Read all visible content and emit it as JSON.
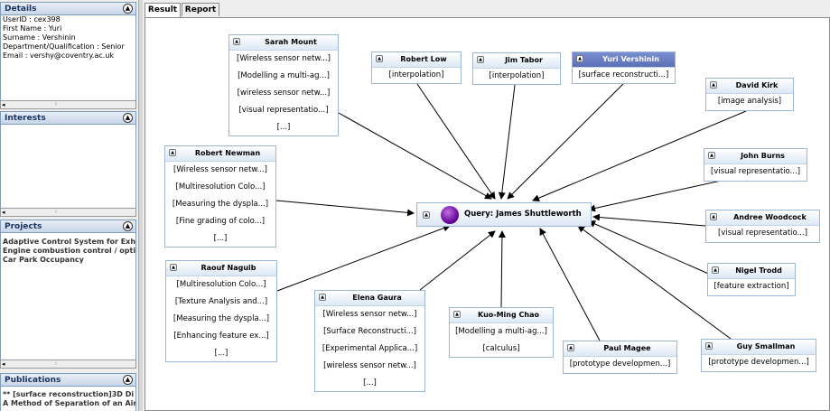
{
  "tabs": [
    "Result",
    "Report"
  ],
  "left": {
    "details": {
      "title": "Details",
      "lines": [
        "UserID : cex398",
        "First Name : Yuri",
        "Surname : Vershinin",
        "Department/Qualification : Senior",
        "Email : vershy@coventry.ac.uk"
      ]
    },
    "interests": {
      "title": "Interests"
    },
    "projects": {
      "title": "Projects",
      "lines": [
        "Adaptive Control System for Exh",
        "Engine combustion control / opti",
        "Car Park Occupancy"
      ]
    },
    "publications": {
      "title": "Publications",
      "lines": [
        "** [surface reconstruction]3D Di",
        "A Method of Separation of an Air"
      ]
    }
  },
  "graph": {
    "query": {
      "label": "Query: James Shuttleworth"
    },
    "nodes": [
      {
        "id": "sarah",
        "name": "Sarah Mount",
        "items": [
          "[Wireless sensor netw...]",
          "[Modelling a multi-ag...]",
          "[wireless sensor netw...]",
          "[visual representatio...]",
          "[...]"
        ]
      },
      {
        "id": "robertlow",
        "name": "Robert Low",
        "items": [
          "[interpolation]"
        ]
      },
      {
        "id": "jimtabor",
        "name": "Jim Tabor",
        "items": [
          "[interpolation]"
        ]
      },
      {
        "id": "yuri",
        "name": "Yuri Vershinin",
        "items": [
          "[surface reconstructi...]"
        ]
      },
      {
        "id": "davidkirk",
        "name": "David Kirk",
        "items": [
          "[image analysis]"
        ]
      },
      {
        "id": "johnburns",
        "name": "John Burns",
        "items": [
          "[visual representatio...]"
        ]
      },
      {
        "id": "andree",
        "name": "Andree Woodcock",
        "items": [
          "[visual representatio...]"
        ]
      },
      {
        "id": "nigel",
        "name": "Nigel Trodd",
        "items": [
          "[feature extraction]"
        ]
      },
      {
        "id": "guy",
        "name": "Guy Smallman",
        "items": [
          "[prototype developmen...]"
        ]
      },
      {
        "id": "paul",
        "name": "Paul Magee",
        "items": [
          "[prototype developmen...]"
        ]
      },
      {
        "id": "kuoming",
        "name": "Kuo-Ming Chao",
        "items": [
          "[Modelling a multi-ag...]",
          "[calculus]"
        ]
      },
      {
        "id": "elena",
        "name": "Elena Gaura",
        "items": [
          "[Wireless sensor netw...]",
          "[Surface Reconstructi...]",
          "[Experimental Applica...]",
          "[wireless sensor netw...]",
          "[...]"
        ]
      },
      {
        "id": "raouf",
        "name": "Raouf Naguib",
        "items": [
          "[Multiresolution Colo...]",
          "[Texture Analysis and...]",
          "[Measuring the dyspla...]",
          "[Enhancing feature ex...]",
          "[...]"
        ]
      },
      {
        "id": "robertnewman",
        "name": "Robert Newman",
        "items": [
          "[Wireless sensor netw...]",
          "[Multiresolution Colo...]",
          "[Measuring the dyspla...]",
          "[Fine grading of colo...]",
          "[...]"
        ]
      }
    ],
    "selected": "yuri"
  }
}
